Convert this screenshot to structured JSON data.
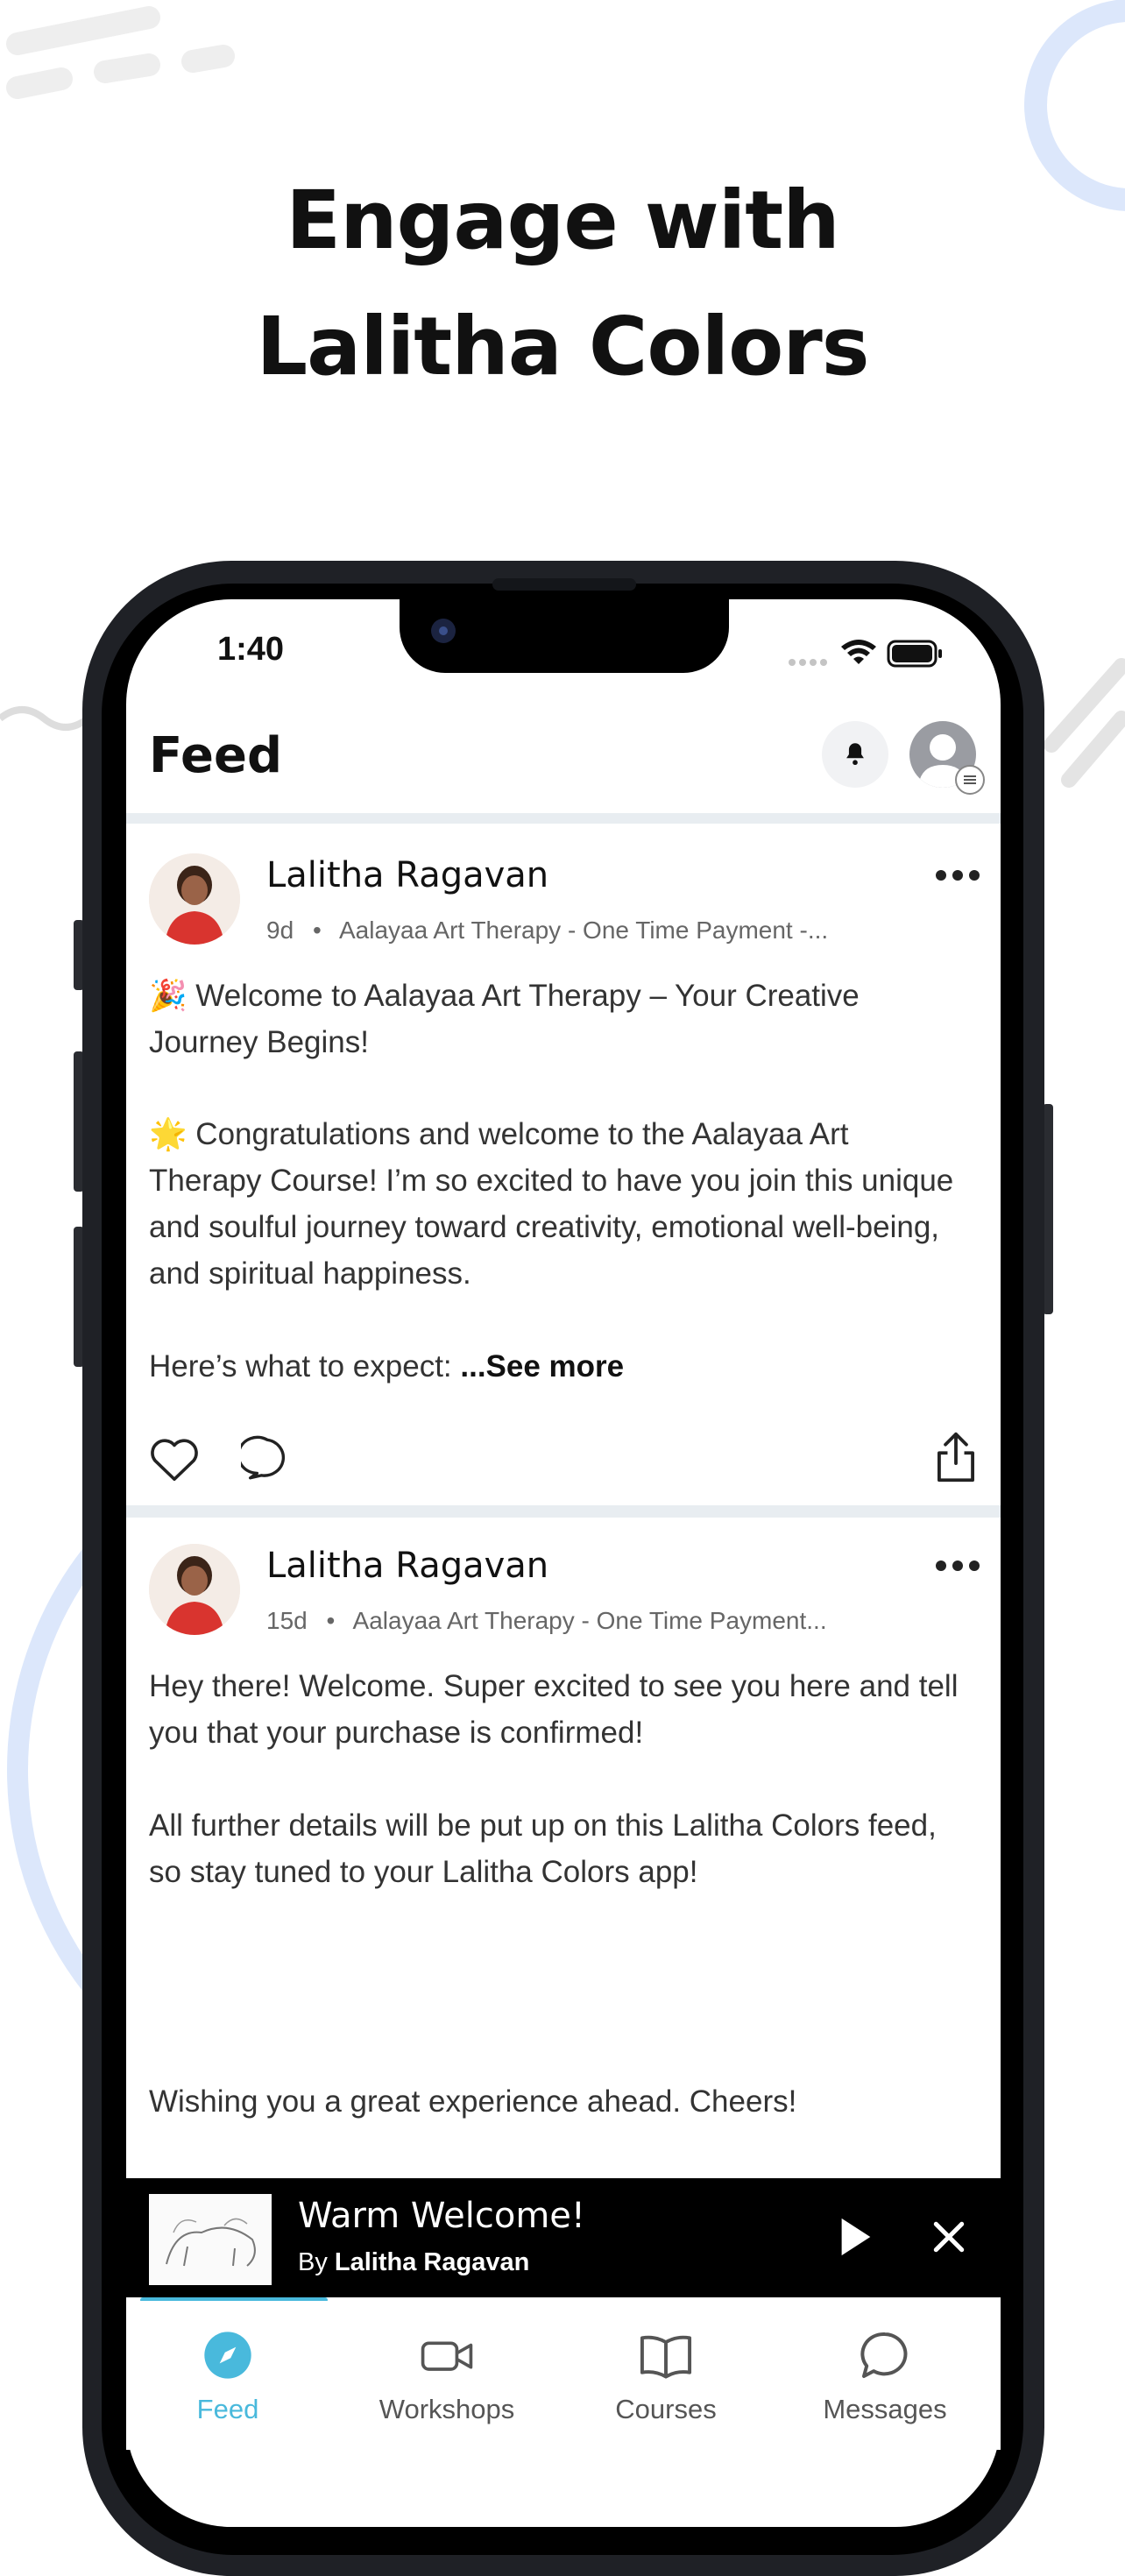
{
  "headline": {
    "line1": "Engage with",
    "line2": "Lalitha Colors"
  },
  "status_bar": {
    "time": "1:40"
  },
  "header": {
    "title": "Feed",
    "bell_icon": "bell-icon",
    "profile_icon": "user-avatar-icon"
  },
  "posts": [
    {
      "author": "Lalitha Ragavan",
      "age": "9d",
      "separator": "•",
      "channel": "Aalayaa Art Therapy - One Time Payment -...",
      "para1": "🎉 Welcome to Aalayaa Art Therapy – Your Creative Journey Begins!",
      "para2": "🌟 Congratulations and welcome to the Aalayaa Art Therapy Course! I’m so excited to have you join this unique and soulful journey toward creativity, emotional well-being, and spiritual happiness.",
      "para3": "Here’s what to expect: ",
      "see_more": "...See more"
    },
    {
      "author": "Lalitha Ragavan",
      "age": "15d",
      "separator": "•",
      "channel": "Aalayaa Art Therapy - One Time Payment...",
      "para1": "Hey there! Welcome. Super excited to see you here and tell you that your purchase is confirmed!",
      "para2": "All further details will be put up on this Lalitha Colors feed, so stay tuned to your Lalitha Colors app!",
      "para3": "Wishing you a great experience ahead. Cheers!"
    }
  ],
  "player": {
    "title": "Warm Welcome!",
    "by_prefix": "By",
    "by_name": "Lalitha Ragavan"
  },
  "tabs": [
    {
      "label": "Feed",
      "icon": "compass-icon",
      "active": true
    },
    {
      "label": "Workshops",
      "icon": "video-camera-icon",
      "active": false
    },
    {
      "label": "Courses",
      "icon": "book-icon",
      "active": false
    },
    {
      "label": "Messages",
      "icon": "chat-bubble-icon",
      "active": false
    }
  ],
  "colors": {
    "accent": "#49b9dc",
    "decor_blue": "#dce7fb"
  }
}
